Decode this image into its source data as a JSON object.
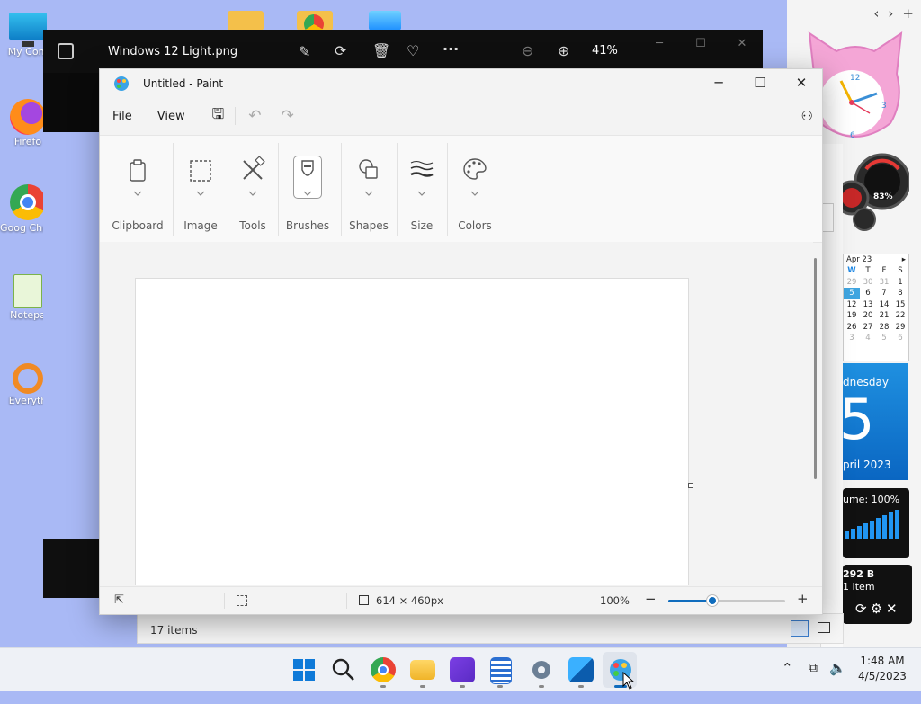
{
  "desktop": {
    "icons": [
      {
        "label": "My Com",
        "icon": "monitor-icon"
      },
      {
        "label": "Firefo",
        "icon": "firefox-icon"
      },
      {
        "label": "Goog Chron",
        "icon": "chrome-icon"
      },
      {
        "label": "Notepa",
        "icon": "notepad-icon"
      },
      {
        "label": "Everyth",
        "icon": "everything-search-icon"
      }
    ]
  },
  "photos": {
    "title": "Windows 12 Light.png",
    "zoom": "41%"
  },
  "explorer": {
    "status": "17 items"
  },
  "paint": {
    "title": "Untitled - Paint",
    "menu": {
      "file": "File",
      "view": "View"
    },
    "groups": [
      {
        "label": "Clipboard",
        "icon": "clipboard-icon"
      },
      {
        "label": "Image",
        "icon": "selection-icon"
      },
      {
        "label": "Tools",
        "icon": "tools-icon"
      },
      {
        "label": "Brushes",
        "icon": "brush-icon"
      },
      {
        "label": "Shapes",
        "icon": "shapes-icon"
      },
      {
        "label": "Size",
        "icon": "size-icon"
      },
      {
        "label": "Colors",
        "icon": "palette-icon"
      }
    ],
    "status": {
      "canvas_size": "614 × 460px",
      "zoom": "100%",
      "zoom_level": 0.38
    }
  },
  "widgets": {
    "gauge_label": "83%",
    "calendar": {
      "header": "Apr 23",
      "weekdays": [
        "W",
        "T",
        "F",
        "S"
      ],
      "rows": [
        [
          "29",
          "30",
          "31",
          "1"
        ],
        [
          "5",
          "6",
          "7",
          "8"
        ],
        [
          "12",
          "13",
          "14",
          "15"
        ],
        [
          "19",
          "20",
          "21",
          "22"
        ],
        [
          "26",
          "27",
          "28",
          "29"
        ],
        [
          "3",
          "4",
          "5",
          "6"
        ]
      ]
    },
    "date": {
      "weekday": "dnesday",
      "day": "5",
      "month": "pril 2023"
    },
    "volume": "ume: 100%",
    "bin": {
      "size": "292 B",
      "items": "1 Item"
    }
  },
  "taskbar": {
    "time": "1:48 AM",
    "date": "4/5/2023"
  }
}
